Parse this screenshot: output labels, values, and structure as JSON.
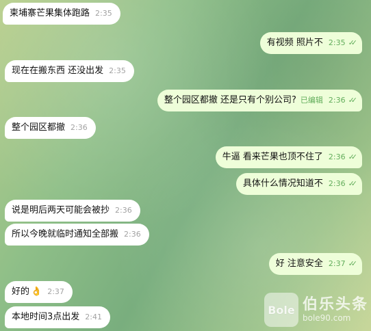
{
  "messages": [
    {
      "id": "m1",
      "dir": "in",
      "text": "柬埔寨芒果集体跑路",
      "time": "2:35"
    },
    {
      "id": "m2",
      "dir": "out",
      "text": "有视频 照片不",
      "time": "2:35"
    },
    {
      "id": "m3",
      "dir": "in",
      "text": "现在在搬东西 还没出发",
      "time": "2:35"
    },
    {
      "id": "m4",
      "dir": "out",
      "text": "整个园区都撤 还是只有个别公司?",
      "edited": "已编辑",
      "time": "2:36"
    },
    {
      "id": "m5",
      "dir": "in",
      "text": "整个园区都撤",
      "time": "2:36"
    },
    {
      "id": "m6",
      "dir": "out",
      "text": "牛逼 看来芒果也顶不住了",
      "time": "2:36"
    },
    {
      "id": "m7",
      "dir": "out",
      "text": "具体什么情况知道不",
      "time": "2:36"
    },
    {
      "id": "m8",
      "dir": "in",
      "text": "说是明后两天可能会被抄",
      "time": "2:36"
    },
    {
      "id": "m9",
      "dir": "in",
      "text": "所以今晚就临时通知全部搬",
      "time": "2:36"
    },
    {
      "id": "m10",
      "dir": "out",
      "text": "好 注意安全",
      "time": "2:37"
    },
    {
      "id": "m11",
      "dir": "in",
      "text": "好的",
      "emoji": "👌",
      "time": "2:37"
    },
    {
      "id": "m12",
      "dir": "in",
      "text": "本地时间3点出发",
      "time": "2:41"
    }
  ],
  "read_ticks": "✓✓",
  "watermark": {
    "logo": "Bole",
    "name": "伯乐头条",
    "url": "bole90.com"
  },
  "colors": {
    "incoming_bubble": "#ffffff",
    "outgoing_bubble": "#eefed9",
    "check_green": "#62ad5b"
  }
}
